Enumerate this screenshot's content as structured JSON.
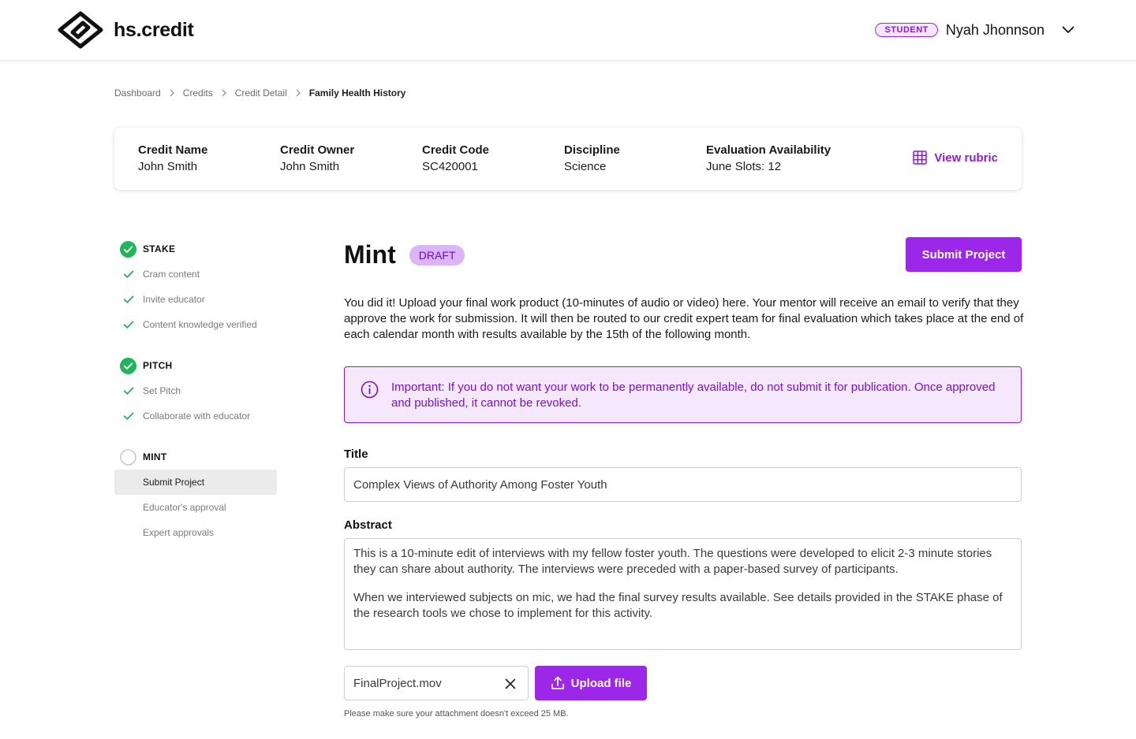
{
  "brand": {
    "name": "hs.credit",
    "logo_icon": "hs-logo-mark"
  },
  "user": {
    "role": "STUDENT",
    "name": "Nyah Jhonnson",
    "menu_icon": "chevron-down-icon"
  },
  "breadcrumb": {
    "items": [
      "Dashboard",
      "Credits",
      "Credit Detail"
    ],
    "current": "Family Health History"
  },
  "credit_info": {
    "name_label": "Credit Name",
    "name_value": "John Smith",
    "owner_label": "Credit Owner",
    "owner_value": "John Smith",
    "code_label": "Credit Code",
    "code_value": "SC420001",
    "discipline_label": "Discipline",
    "discipline_value": "Science",
    "availability_label": "Evaluation Availability",
    "availability_value": "June Slots: 12",
    "rubric_label": "View rubric"
  },
  "steps": {
    "stake": {
      "label": "STAKE",
      "status": "complete",
      "items": [
        "Cram content",
        "Invite educator",
        "Content knowledge verified"
      ]
    },
    "pitch": {
      "label": "PITCH",
      "status": "complete",
      "items": [
        "Set Pitch",
        "Collaborate with educator"
      ]
    },
    "mint": {
      "label": "MINT",
      "status": "in-progress",
      "items": [
        "Submit Project",
        "Educator's approval",
        "Expert approvals"
      ],
      "active_index": 0
    }
  },
  "main": {
    "title": "Mint",
    "status_badge": "DRAFT",
    "submit_label": "Submit Project",
    "intro": "You did it! Upload your final work product (10-minutes of audio or video) here. Your mentor will receive an email to verify that they approve the work for submission. It will then be routed to our credit expert team for final evaluation which takes place at the end of each calendar month with results available by the 15th of the following month.",
    "alert": "Important: If you do not want your work to be permanently available, do not submit it for publication. Once approved and published, it cannot be revoked.",
    "title_label": "Title",
    "title_value": "Complex Views of Authority Among Foster Youth",
    "abstract_label": "Abstract",
    "abstract_p1": "This is a 10-minute edit of interviews with my fellow foster youth. The questions were developed to elicit 2-3 minute stories they can share about authority. The interviews were preceded with a paper-based survey of participants.",
    "abstract_p2": "When we interviewed subjects on mic, we had the final survey results available. See details provided in the STAKE phase of the research tools we chose to implement for this activity.",
    "file_name": "FinalProject.mov",
    "upload_label": "Upload file",
    "upload_hint": "Please make sure your attachment doesn't exceed 25 MB."
  },
  "colors": {
    "accent": "#9c27e8",
    "accent_light": "#f5e8fd",
    "success": "#22b45a",
    "draft_bg": "#dcb4fa"
  }
}
